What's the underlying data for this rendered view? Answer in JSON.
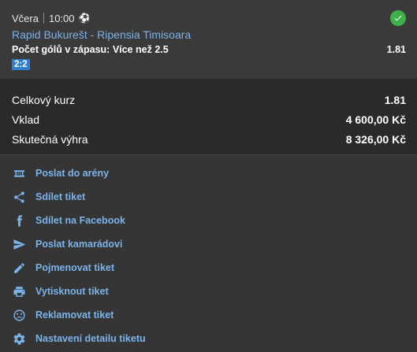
{
  "bet": {
    "day": "Včera",
    "time": "10:00",
    "sport_icon": "soccer-ball-icon",
    "status_icon": "check-circle-icon",
    "match": "Rapid Bukurešt - Ripensia Timisoara",
    "market_label": "Počet gólů v zápasu:",
    "market_pick": "Více než 2.5",
    "odds": "1.81",
    "score": "2:2"
  },
  "summary": {
    "total_odds_label": "Celkový kurz",
    "total_odds_value": "1.81",
    "stake_label": "Vklad",
    "stake_value": "4 600,00 Kč",
    "payout_label": "Skutečná výhra",
    "payout_value": "8 326,00 Kč"
  },
  "actions": [
    {
      "label": "Poslat do arény",
      "icon": "arena-icon"
    },
    {
      "label": "Sdílet tiket",
      "icon": "share-icon"
    },
    {
      "label": "Sdílet na Facebook",
      "icon": "facebook-icon"
    },
    {
      "label": "Poslat kamarádovi",
      "icon": "send-icon"
    },
    {
      "label": "Pojmenovat tiket",
      "icon": "pencil-icon"
    },
    {
      "label": "Vytisknout tiket",
      "icon": "printer-icon"
    },
    {
      "label": "Reklamovat tiket",
      "icon": "sad-face-icon"
    },
    {
      "label": "Nastavení detailu tiketu",
      "icon": "gear-icon"
    }
  ],
  "colors": {
    "link": "#7ab3ea",
    "success": "#3eb049",
    "score_badge": "#2e7fd1"
  }
}
